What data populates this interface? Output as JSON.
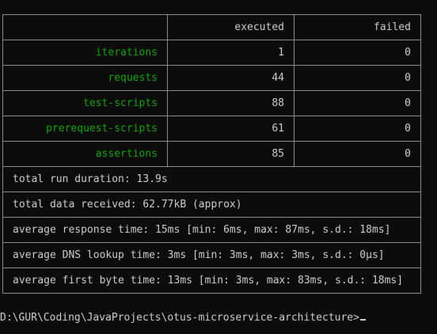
{
  "table": {
    "header": {
      "name": "",
      "executed": "executed",
      "failed": "failed"
    },
    "rows": [
      {
        "name": "iterations",
        "executed": "1",
        "failed": "0"
      },
      {
        "name": "requests",
        "executed": "44",
        "failed": "0"
      },
      {
        "name": "test-scripts",
        "executed": "88",
        "failed": "0"
      },
      {
        "name": "prerequest-scripts",
        "executed": "61",
        "failed": "0"
      },
      {
        "name": "assertions",
        "executed": "85",
        "failed": "0"
      }
    ],
    "summary": [
      "total run duration: 13.9s",
      "total data received: 62.77kB (approx)",
      "average response time: 15ms [min: 6ms, max: 87ms, s.d.: 18ms]",
      "average DNS lookup time: 3ms [min: 3ms, max: 3ms, s.d.: 0µs]",
      "average first byte time: 13ms [min: 3ms, max: 83ms, s.d.: 18ms]"
    ]
  },
  "prompt": {
    "path": "D:\\GUR\\Coding\\JavaProjects\\otus-microservice-architecture>"
  },
  "colors": {
    "background": "#0c0c0c",
    "text": "#cccccc",
    "label_green": "#13a10e",
    "border": "#8a8a8a"
  }
}
